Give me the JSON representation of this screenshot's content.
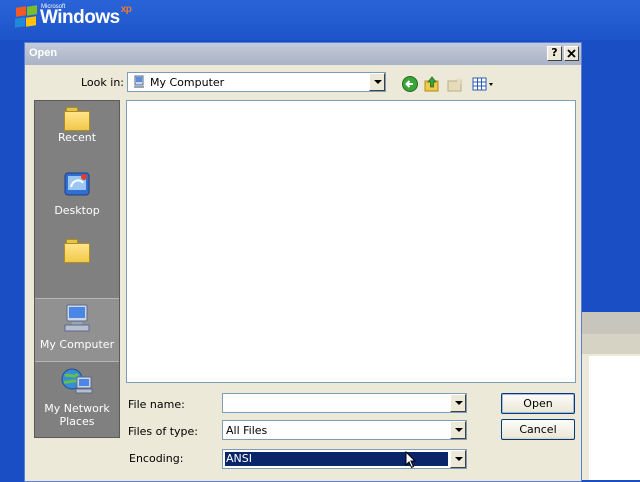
{
  "desktop": {
    "logo_small": "Microsoft",
    "logo_word": "Windows",
    "logo_sup": "xp"
  },
  "dialog": {
    "title": "Open",
    "help_button": "?",
    "close_button": "X",
    "look_in_label": "Look in:",
    "look_in_value": "My Computer",
    "toolbar_icons": [
      "back-icon",
      "up-folder-icon",
      "new-folder-icon",
      "views-menu-icon"
    ],
    "places": [
      {
        "label": "Recent",
        "icon": "folder-icon"
      },
      {
        "label": "Desktop",
        "icon": "desktop-icon"
      },
      {
        "label": "",
        "icon": "folder-icon"
      },
      {
        "label": "My Computer",
        "icon": "my-computer-icon"
      },
      {
        "label": "My Network Places",
        "icon": "network-places-icon"
      }
    ],
    "file_name_label": "File name:",
    "file_name_value": "",
    "files_of_type_label": "Files of type:",
    "files_of_type_value": "All Files",
    "encoding_label": "Encoding:",
    "encoding_value": "ANSI",
    "open_button": "Open",
    "cancel_button": "Cancel"
  }
}
